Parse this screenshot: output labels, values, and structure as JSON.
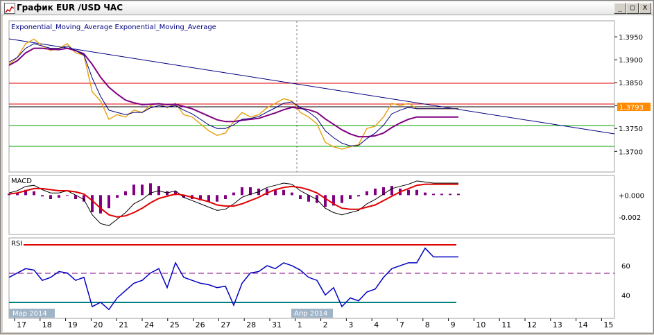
{
  "window": {
    "title": "График EUR /USD ЧАС",
    "buttons": {
      "minimize": "_",
      "maximize": "□",
      "close": "X"
    }
  },
  "colors": {
    "price": "#e8a317",
    "ema_fast": "#000080",
    "ema_slow": "#800080",
    "trend": "#000080",
    "red_line": "#e00000",
    "green_line": "#00a000",
    "black_line": "#000000",
    "macd_line": "#000000",
    "signal_line": "#e00000",
    "histogram": "#800080",
    "rsi": "#0000c0",
    "rsi_high": "#e00000",
    "rsi_low": "#008080",
    "rsi_mid": "#800080",
    "price_label_bg": "#ff8c00"
  },
  "x_axis": {
    "labels": [
      "17",
      "18",
      "19",
      "20",
      "21",
      "24",
      "25",
      "26",
      "27",
      "28",
      "31",
      "1",
      "2",
      "3",
      "4",
      "7",
      "8",
      "9",
      "10",
      "11",
      "12",
      "13",
      "14",
      "15"
    ],
    "month_labels": [
      "Мар 2014",
      "Апр 2014"
    ]
  },
  "price_panel": {
    "legend": "Exponential_Moving_Average Exponential_Moving_Average",
    "y_ticks": [
      "1.3950",
      "1.3900",
      "1.3850",
      "1.3800",
      "1.3750",
      "1.3700"
    ],
    "current_price": "1.3793",
    "chart_data": {
      "type": "line",
      "ylim": [
        1.3655,
        1.3985
      ],
      "x": [
        0,
        12,
        24,
        36,
        48,
        60,
        72,
        84,
        96,
        108,
        120,
        132,
        144,
        156,
        168,
        180,
        192,
        204,
        216,
        228,
        240,
        252,
        264,
        276,
        288,
        300,
        312,
        324,
        336,
        348,
        360,
        372,
        384,
        396,
        408,
        420,
        432,
        444,
        456,
        468,
        480,
        492,
        504,
        516,
        528,
        540,
        552,
        564,
        576,
        588,
        600,
        612,
        624,
        636,
        648
      ],
      "series": [
        {
          "name": "price",
          "values": [
            1.389,
            1.3905,
            1.3935,
            1.3945,
            1.393,
            1.392,
            1.3925,
            1.3935,
            1.3915,
            1.391,
            1.383,
            1.381,
            1.377,
            1.378,
            1.3775,
            1.379,
            1.3785,
            1.38,
            1.3805,
            1.3795,
            1.3805,
            1.378,
            1.3775,
            1.376,
            1.3745,
            1.3735,
            1.374,
            1.3765,
            1.3785,
            1.3775,
            1.378,
            1.3795,
            1.3805,
            1.3815,
            1.381,
            1.3785,
            1.3775,
            1.376,
            1.372,
            1.371,
            1.3705,
            1.371,
            1.3715,
            1.375,
            1.3755,
            1.3775,
            1.3805,
            1.38,
            1.3805,
            1.3793,
            1.3793,
            1.3793,
            1.3793,
            1.3793,
            1.3793
          ]
        },
        {
          "name": "ema_fast",
          "values": [
            1.3895,
            1.3905,
            1.3925,
            1.3935,
            1.393,
            1.3925,
            1.3925,
            1.393,
            1.392,
            1.391,
            1.386,
            1.382,
            1.379,
            1.3785,
            1.378,
            1.3785,
            1.3785,
            1.3795,
            1.38,
            1.3797,
            1.38,
            1.379,
            1.3782,
            1.377,
            1.3758,
            1.375,
            1.375,
            1.3758,
            1.377,
            1.3772,
            1.3776,
            1.3786,
            1.3795,
            1.3805,
            1.3808,
            1.3796,
            1.3786,
            1.3772,
            1.3745,
            1.373,
            1.3718,
            1.3712,
            1.3713,
            1.3728,
            1.374,
            1.3757,
            1.3782,
            1.379,
            1.3796,
            1.3793,
            1.3793,
            1.3793,
            1.3793,
            1.3793,
            1.3793
          ]
        },
        {
          "name": "ema_slow",
          "values": [
            1.3888,
            1.3898,
            1.3915,
            1.3925,
            1.3925,
            1.3923,
            1.3922,
            1.3925,
            1.392,
            1.3913,
            1.389,
            1.3862,
            1.384,
            1.3825,
            1.3812,
            1.3806,
            1.3802,
            1.3803,
            1.3804,
            1.3802,
            1.3803,
            1.3798,
            1.3793,
            1.3785,
            1.3777,
            1.3769,
            1.3765,
            1.3765,
            1.3768,
            1.377,
            1.3772,
            1.3778,
            1.3784,
            1.3791,
            1.3796,
            1.3794,
            1.3791,
            1.3785,
            1.3771,
            1.3759,
            1.3747,
            1.3738,
            1.3732,
            1.3732,
            1.3734,
            1.374,
            1.3752,
            1.3762,
            1.377,
            1.3775,
            1.3775,
            1.3775,
            1.3775,
            1.3775,
            1.3775
          ]
        }
      ]
    }
  },
  "macd_panel": {
    "label": "MACD",
    "y_ticks": [
      "+0.000",
      "-0.002"
    ],
    "chart_data": {
      "type": "line",
      "ylim": [
        -0.0036,
        0.0018
      ],
      "x": [
        0,
        12,
        24,
        36,
        48,
        60,
        72,
        84,
        96,
        108,
        120,
        132,
        144,
        156,
        168,
        180,
        192,
        204,
        216,
        228,
        240,
        252,
        264,
        276,
        288,
        300,
        312,
        324,
        336,
        348,
        360,
        372,
        384,
        396,
        408,
        420,
        432,
        444,
        456,
        468,
        480,
        492,
        504,
        516,
        528,
        540,
        552,
        564,
        576,
        588,
        600,
        612,
        624,
        636,
        648
      ],
      "series": [
        {
          "name": "macd",
          "values": [
            0.0002,
            0.0004,
            0.0008,
            0.0009,
            0.0005,
            0.0002,
            0.0002,
            0.0004,
            0.0,
            -0.0004,
            -0.0018,
            -0.0026,
            -0.0028,
            -0.0022,
            -0.0016,
            -0.0008,
            -0.0004,
            0.0002,
            0.0004,
            0.0002,
            0.0004,
            -0.0002,
            -0.0005,
            -0.0008,
            -0.0011,
            -0.0014,
            -0.0013,
            -0.0008,
            -0.0002,
            0.0001,
            0.0003,
            0.0007,
            0.0009,
            0.0011,
            0.001,
            0.0004,
            0.0,
            -0.0004,
            -0.0012,
            -0.0016,
            -0.0018,
            -0.0016,
            -0.0014,
            -0.0008,
            -0.0004,
            0.0001,
            0.0006,
            0.0008,
            0.001,
            0.0013,
            0.0012,
            0.0011,
            0.0011,
            0.0011,
            0.0011
          ]
        },
        {
          "name": "signal",
          "values": [
            0.0001,
            0.0002,
            0.0004,
            0.0006,
            0.0006,
            0.0005,
            0.0004,
            0.0004,
            0.0003,
            0.0001,
            -0.0005,
            -0.0012,
            -0.0018,
            -0.002,
            -0.0019,
            -0.0016,
            -0.0012,
            -0.0007,
            -0.0003,
            -0.0001,
            0.0001,
            0.0,
            -0.0002,
            -0.0004,
            -0.0006,
            -0.0009,
            -0.001,
            -0.001,
            -0.0008,
            -0.0005,
            -0.0002,
            0.0002,
            0.0005,
            0.0007,
            0.0008,
            0.0007,
            0.0005,
            0.0002,
            -0.0003,
            -0.0008,
            -0.0012,
            -0.0013,
            -0.0013,
            -0.0011,
            -0.0009,
            -0.0005,
            -0.0001,
            0.0003,
            0.0006,
            0.0009,
            0.001,
            0.001,
            0.001,
            0.001,
            0.001
          ]
        }
      ]
    }
  },
  "rsi_panel": {
    "label": "RSI",
    "y_ticks": [
      "60",
      "40"
    ],
    "chart_data": {
      "type": "line",
      "ylim": [
        24,
        79
      ],
      "x": [
        0,
        12,
        24,
        36,
        48,
        60,
        72,
        84,
        96,
        108,
        120,
        132,
        144,
        156,
        168,
        180,
        192,
        204,
        216,
        228,
        240,
        252,
        264,
        276,
        288,
        300,
        312,
        324,
        336,
        348,
        360,
        372,
        384,
        396,
        408,
        420,
        432,
        444,
        456,
        468,
        480,
        492,
        504,
        516,
        528,
        540,
        552,
        564,
        576,
        588,
        600,
        612,
        624,
        636,
        648
      ],
      "series": [
        {
          "name": "rsi",
          "values": [
            52,
            55,
            58,
            57,
            50,
            52,
            56,
            55,
            50,
            52,
            32,
            35,
            30,
            38,
            43,
            48,
            50,
            55,
            58,
            45,
            62,
            52,
            50,
            48,
            47,
            45,
            46,
            33,
            48,
            55,
            56,
            60,
            58,
            62,
            60,
            57,
            52,
            50,
            40,
            45,
            32,
            38,
            36,
            42,
            44,
            52,
            58,
            60,
            62,
            62,
            72,
            66,
            66,
            66,
            66
          ]
        }
      ]
    }
  }
}
